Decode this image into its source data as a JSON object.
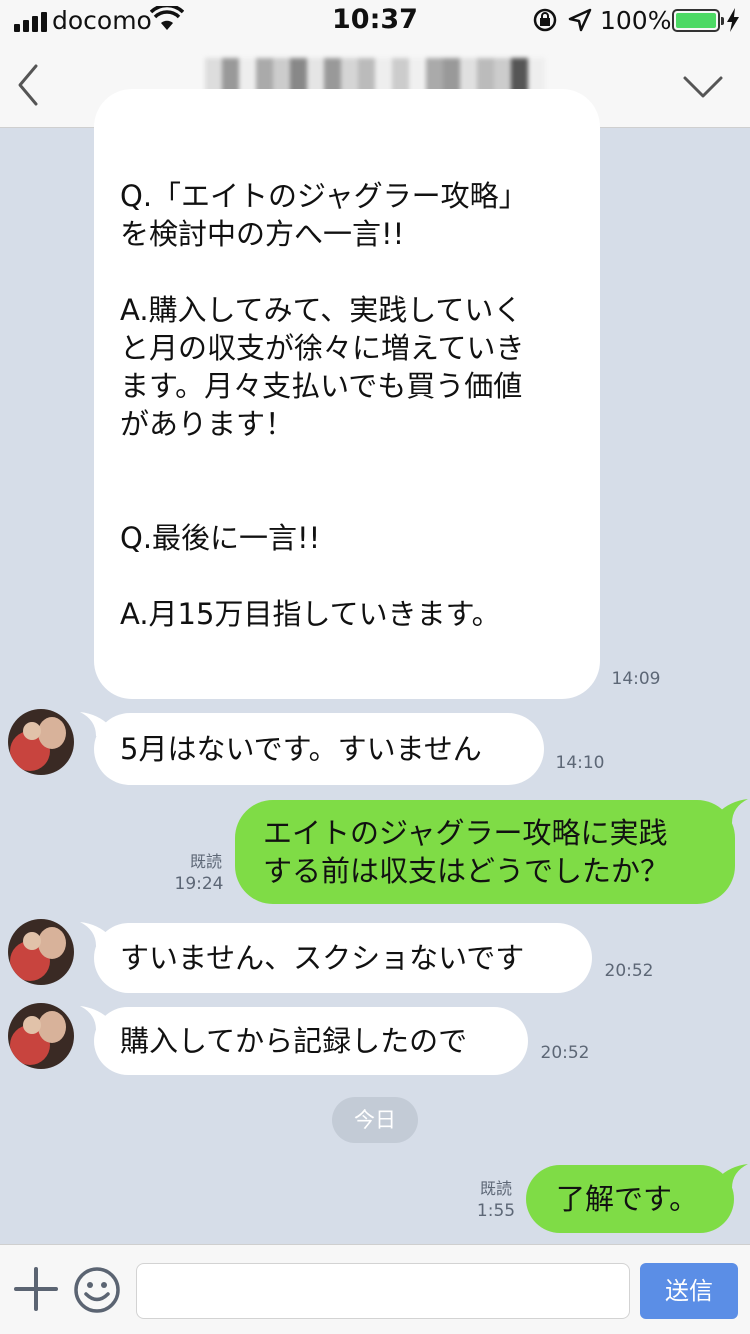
{
  "status_bar": {
    "carrier": "docomo",
    "time": "10:37",
    "battery": "100%",
    "battery_level": 1.0
  },
  "colors": {
    "incoming_bubble": "#ffffff",
    "outgoing_bubble": "#7fdc46",
    "chat_bg": "#d6dde8",
    "send_button": "#5b8ee6"
  },
  "header": {
    "back_icon": "chevron-left-icon",
    "menu_icon": "chevron-down-icon"
  },
  "messages": [
    {
      "side": "in",
      "lines": [
        "Q.「エイトのジャグラー攻略」",
        "を検討中の方へ一言!!",
        "",
        "A.購入してみて、実践していく",
        "と月の収支が徐々に増えていき",
        "ます。月々支払いでも買う価値",
        "があります！",
        "",
        "",
        "Q.最後に一言!!",
        "",
        "A.月15万目指していきます。"
      ],
      "time": "14:09"
    },
    {
      "side": "in",
      "text": "5月はないです。すいません",
      "time": "14:10"
    },
    {
      "side": "out",
      "lines": [
        "エイトのジャグラー攻略に実践",
        "する前は収支はどうでしたか？"
      ],
      "read": "既読",
      "time": "19:24"
    },
    {
      "side": "in",
      "text": "すいません、スクショないです",
      "time": "20:52"
    },
    {
      "side": "in",
      "text": "購入してから記録したので",
      "time": "20:52"
    },
    {
      "date_divider": "今日"
    },
    {
      "side": "out",
      "text": "了解です。",
      "read": "既読",
      "time": "1:55"
    }
  ],
  "input_bar": {
    "placeholder": "",
    "send_label": "送信",
    "plus_icon": "plus-icon",
    "emoji_icon": "smiley-icon"
  }
}
